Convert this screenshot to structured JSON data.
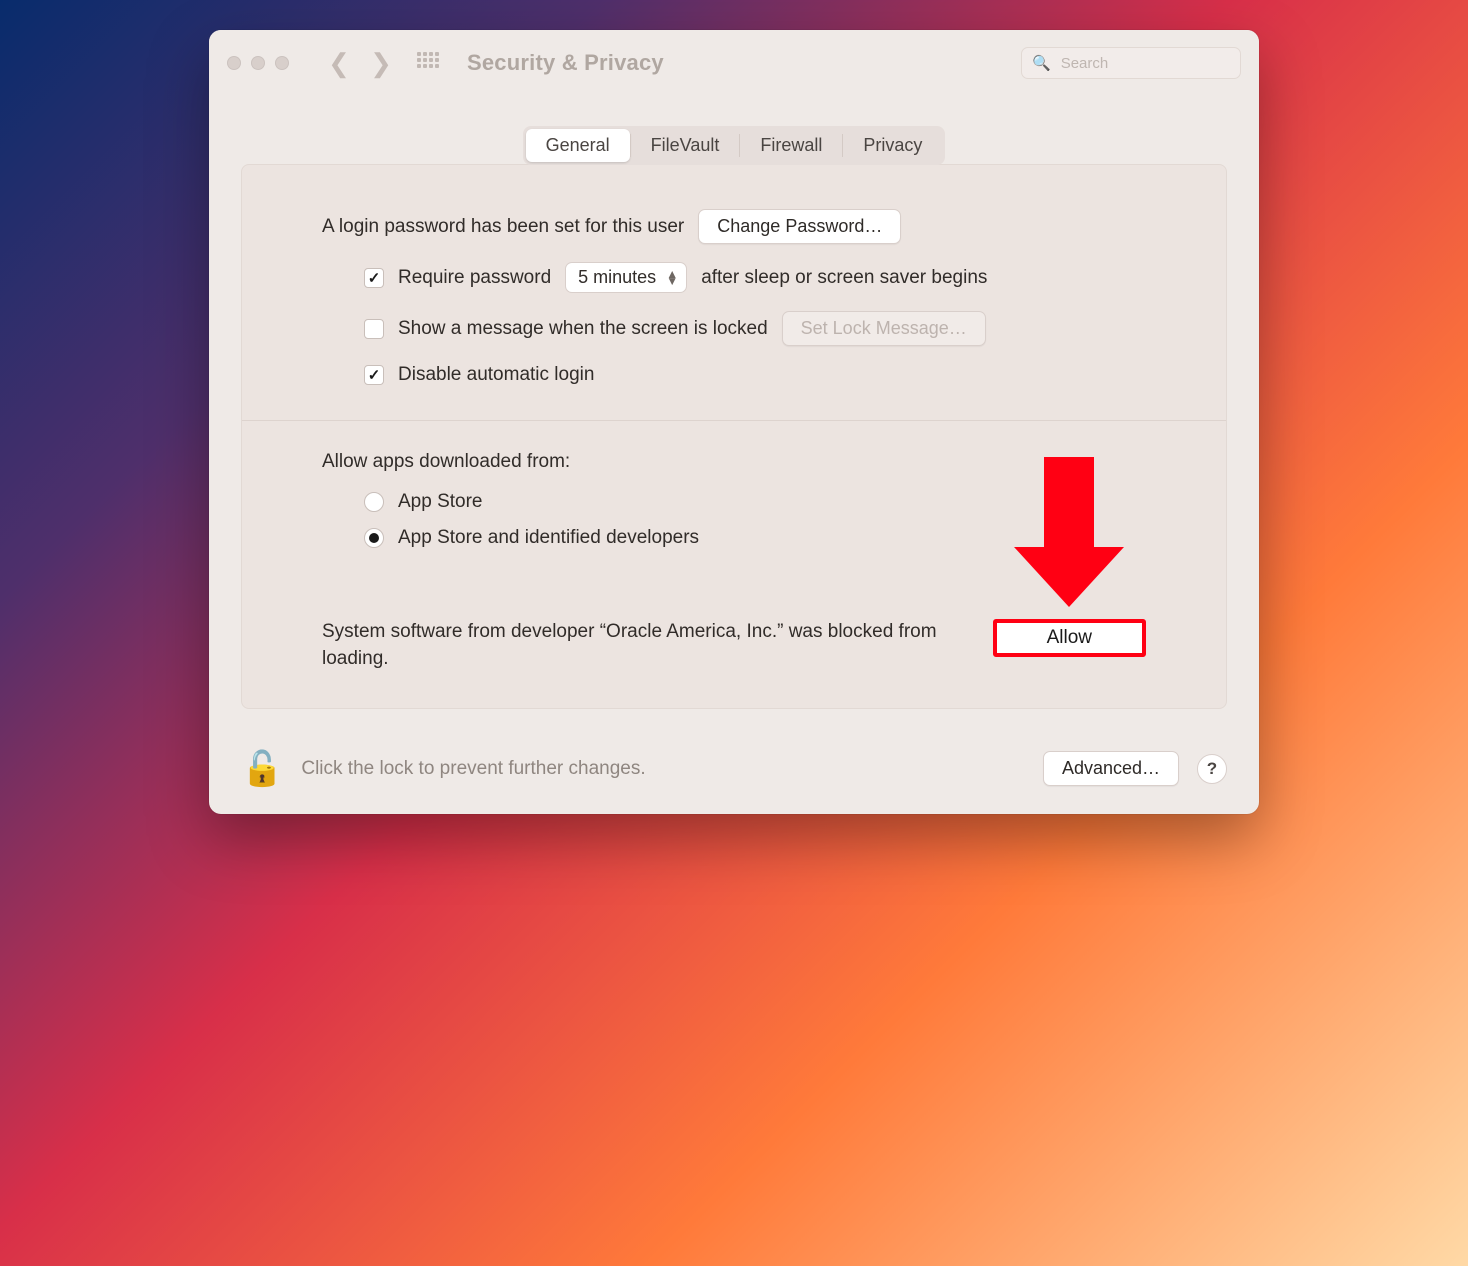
{
  "windowTitle": "Security & Privacy",
  "search": {
    "placeholder": "Search"
  },
  "tabs": {
    "general": "General",
    "filevault": "FileVault",
    "firewall": "Firewall",
    "privacy": "Privacy",
    "active": "general"
  },
  "login": {
    "text": "A login password has been set for this user",
    "changePassword": "Change Password…",
    "requireLabel": "Require password",
    "requireValue": "5 minutes",
    "requireAfter": "after sleep or screen saver begins",
    "showMessage": "Show a message when the screen is locked",
    "setLockMessage": "Set Lock Message…",
    "disableAuto": "Disable automatic login"
  },
  "allowApps": {
    "heading": "Allow apps downloaded from:",
    "opt1": "App Store",
    "opt2": "App Store and identified developers",
    "selected": "opt2"
  },
  "blocked": {
    "text": "System software from developer “Oracle America, Inc.” was blocked from loading.",
    "allow": "Allow"
  },
  "footer": {
    "text": "Click the lock to prevent further changes.",
    "advanced": "Advanced…",
    "help": "?"
  }
}
